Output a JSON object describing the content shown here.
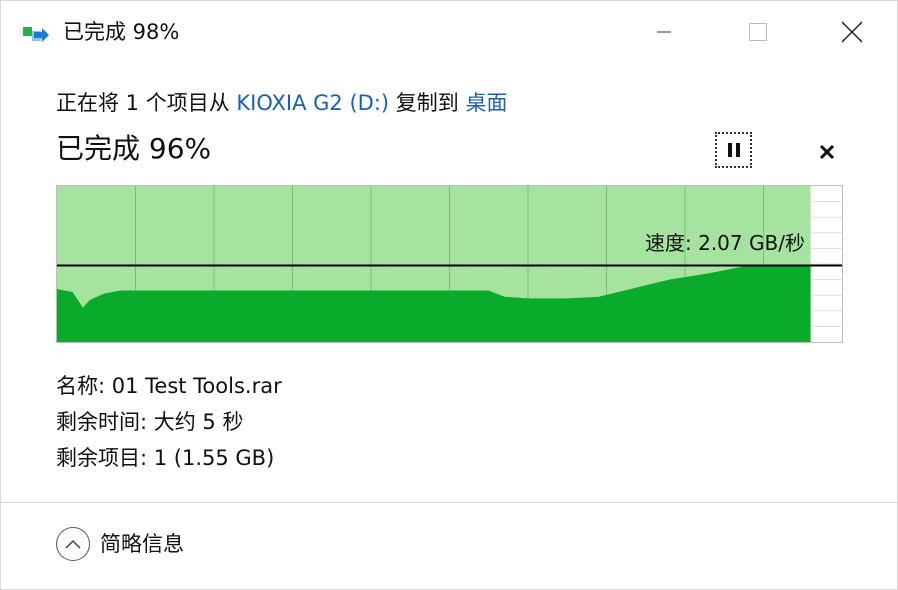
{
  "window": {
    "title": "已完成 98%",
    "icon": "copy-arrow-icon"
  },
  "copy": {
    "prefix": "正在将 1 个项目从 ",
    "source": "KIOXIA G2 (D:)",
    "middle": " 复制到 ",
    "destination": "桌面",
    "progress_text": "已完成 96%",
    "progress_fraction": 0.96
  },
  "controls": {
    "pause_icon": "pause-icon",
    "cancel_icon": "close-icon"
  },
  "chart_data": {
    "type": "area",
    "speed_label": "速度: 2.07 GB/秒",
    "y_max_relative": 1.0,
    "progress": 0.96,
    "current_speed_relative": 0.49,
    "x": [
      0,
      0.02,
      0.033,
      0.042,
      0.06,
      0.08,
      0.1,
      0.12,
      0.19,
      0.3,
      0.55,
      0.57,
      0.6,
      0.65,
      0.69,
      0.78,
      0.83,
      0.88,
      0.96
    ],
    "values": [
      0.34,
      0.32,
      0.22,
      0.27,
      0.31,
      0.33,
      0.33,
      0.33,
      0.33,
      0.33,
      0.33,
      0.29,
      0.28,
      0.28,
      0.29,
      0.4,
      0.44,
      0.49,
      0.49
    ],
    "grid": true,
    "colors": {
      "past_fill": "#a6e3a1",
      "area_fill": "#0aaa2a",
      "grid": "#6fc76c",
      "speed_line": "#000000",
      "border": "#bdbdbd"
    }
  },
  "details": {
    "name": "名称: 01 Test Tools.rar",
    "time_remaining": "剩余时间: 大约 5 秒",
    "items_remaining": "剩余项目: 1 (1.55 GB)"
  },
  "footer": {
    "toggle_label": "简略信息",
    "toggle_icon": "chevron-up-icon"
  }
}
